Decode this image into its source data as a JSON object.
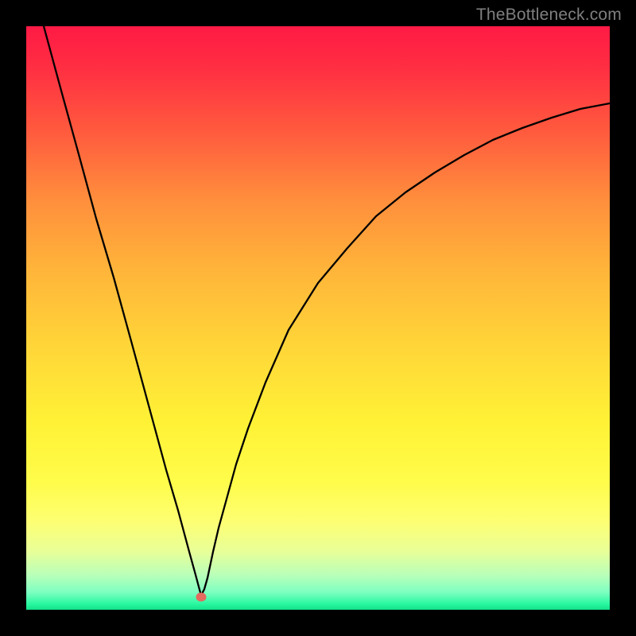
{
  "watermark": "TheBottleneck.com",
  "marker": {
    "x_frac": 0.299,
    "y_frac": 0.978
  },
  "chart_data": {
    "type": "line",
    "title": "",
    "xlabel": "",
    "ylabel": "",
    "xlim": [
      0,
      100
    ],
    "ylim": [
      0,
      100
    ],
    "grid": false,
    "legend": false,
    "series": [
      {
        "name": "curve",
        "x": [
          3.0,
          6.0,
          9.0,
          12.0,
          15.0,
          18.0,
          21.0,
          24.0,
          26.0,
          28.0,
          29.0,
          29.5,
          30.0,
          30.5,
          31.0,
          32.0,
          33.0,
          34.0,
          36.0,
          38.0,
          41.0,
          45.0,
          50.0,
          55.0,
          60.0,
          65.0,
          70.0,
          75.0,
          80.0,
          85.0,
          90.0,
          95.0,
          100.0
        ],
        "y": [
          100.0,
          89.0,
          78.0,
          67.0,
          57.0,
          46.0,
          35.0,
          24.0,
          17.0,
          10.0,
          6.0,
          4.0,
          2.5,
          3.5,
          5.5,
          10.0,
          14.0,
          18.0,
          25.0,
          31.0,
          39.0,
          48.0,
          56.0,
          62.0,
          67.5,
          71.5,
          75.0,
          78.0,
          80.5,
          82.5,
          84.3,
          85.8,
          86.8
        ]
      }
    ],
    "annotations": [
      {
        "name": "marker",
        "x": 29.9,
        "y": 2.2
      }
    ]
  }
}
